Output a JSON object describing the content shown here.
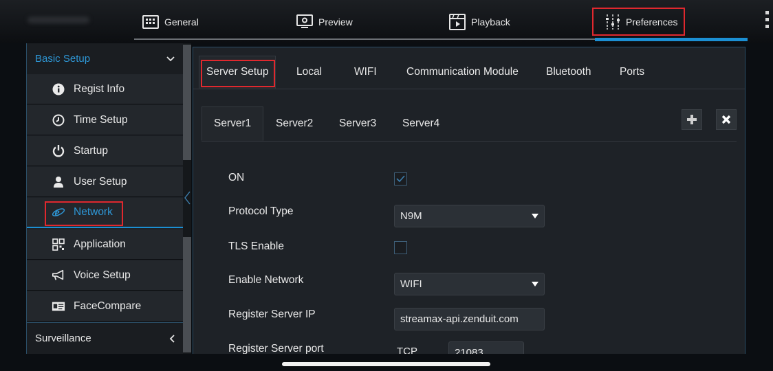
{
  "nav": {
    "general": "General",
    "preview": "Preview",
    "playback": "Playback",
    "preferences": "Preferences",
    "active": "Preferences"
  },
  "sidebar": {
    "section": "Basic Setup",
    "items": [
      {
        "label": "Regist Info",
        "icon": "info-icon"
      },
      {
        "label": "Time Setup",
        "icon": "clock-icon"
      },
      {
        "label": "Startup",
        "icon": "power-icon"
      },
      {
        "label": "User Setup",
        "icon": "user-icon"
      },
      {
        "label": "Network",
        "icon": "network-e-icon"
      },
      {
        "label": "Application",
        "icon": "qr-icon"
      },
      {
        "label": "Voice Setup",
        "icon": "megaphone-icon"
      },
      {
        "label": "FaceCompare",
        "icon": "id-card-icon"
      }
    ],
    "active": "Network",
    "footer_section": "Surveillance"
  },
  "tabs": [
    "Server Setup",
    "Local",
    "WIFI",
    "Communication Module",
    "Bluetooth",
    "Ports"
  ],
  "active_tab": "Server Setup",
  "server_tabs": [
    "Server1",
    "Server2",
    "Server3",
    "Server4"
  ],
  "active_server_tab": "Server1",
  "form": {
    "on_label": "ON",
    "on_checked": true,
    "protocol_label": "Protocol Type",
    "protocol_value": "N9M",
    "tls_label": "TLS Enable",
    "tls_checked": false,
    "enable_network_label": "Enable Network",
    "enable_network_value": "WIFI",
    "server_ip_label": "Register Server IP",
    "server_ip_value": "streamax-api.zenduit.com",
    "server_port_label": "Register Server port",
    "server_port_protocol": "TCP",
    "server_port_value": "21083"
  },
  "colors": {
    "accent": "#1b8fd3",
    "highlight_box": "#e0282e",
    "panel": "#1e2227"
  }
}
